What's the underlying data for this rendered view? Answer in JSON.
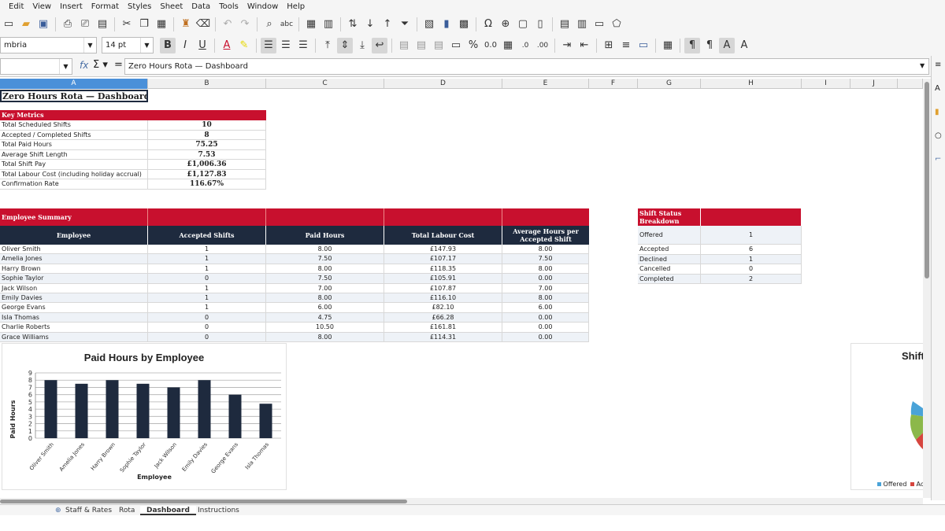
{
  "menu": [
    "Edit",
    "View",
    "Insert",
    "Format",
    "Styles",
    "Sheet",
    "Data",
    "Tools",
    "Window",
    "Help"
  ],
  "format": {
    "font_name": "mbria",
    "font_size": "14 pt"
  },
  "formula": {
    "name_box": "",
    "content": "Zero Hours Rota — Dashboard"
  },
  "columns": [
    "A",
    "B",
    "C",
    "D",
    "E",
    "F",
    "G",
    "H",
    "I",
    "J"
  ],
  "sheet_title": "Zero Hours Rota — Dashboard",
  "key_metrics": {
    "header": "Key Metrics",
    "rows": [
      {
        "label": "Total Scheduled Shifts",
        "value": "10"
      },
      {
        "label": "Accepted / Completed Shifts",
        "value": "8"
      },
      {
        "label": "Total Paid Hours",
        "value": "75.25"
      },
      {
        "label": "Average Shift Length",
        "value": "7.53"
      },
      {
        "label": "Total Shift Pay",
        "value": "£1,006.36"
      },
      {
        "label": "Total Labour Cost (including holiday accrual)",
        "value": "£1,127.83"
      },
      {
        "label": "Confirmation Rate",
        "value": "116.67%"
      }
    ]
  },
  "employee_summary": {
    "header": "Employee Summary",
    "columns": [
      "Employee",
      "Accepted Shifts",
      "Paid Hours",
      "Total Labour Cost",
      "Average Hours per Accepted Shift"
    ],
    "rows": [
      [
        "Oliver Smith",
        "1",
        "8.00",
        "£147.93",
        "8.00"
      ],
      [
        "Amelia Jones",
        "1",
        "7.50",
        "£107.17",
        "7.50"
      ],
      [
        "Harry Brown",
        "1",
        "8.00",
        "£118.35",
        "8.00"
      ],
      [
        "Sophie Taylor",
        "0",
        "7.50",
        "£105.91",
        "0.00"
      ],
      [
        "Jack Wilson",
        "1",
        "7.00",
        "£107.87",
        "7.00"
      ],
      [
        "Emily Davies",
        "1",
        "8.00",
        "£116.10",
        "8.00"
      ],
      [
        "George Evans",
        "1",
        "6.00",
        "£82.10",
        "6.00"
      ],
      [
        "Isla Thomas",
        "0",
        "4.75",
        "£66.28",
        "0.00"
      ],
      [
        "Charlie Roberts",
        "0",
        "10.50",
        "£161.81",
        "0.00"
      ],
      [
        "Grace Williams",
        "0",
        "8.00",
        "£114.31",
        "0.00"
      ]
    ]
  },
  "status_breakdown": {
    "header": "Shift Status Breakdown",
    "rows": [
      {
        "label": "Offered",
        "value": "1"
      },
      {
        "label": "Accepted",
        "value": "6"
      },
      {
        "label": "Declined",
        "value": "1"
      },
      {
        "label": "Cancelled",
        "value": "0"
      },
      {
        "label": "Completed",
        "value": "2"
      }
    ]
  },
  "chart_data": [
    {
      "type": "bar",
      "title": "Paid Hours by Employee",
      "xlabel": "Employee",
      "ylabel": "Paid Hours",
      "categories": [
        "Oliver Smith",
        "Amelia Jones",
        "Harry Brown",
        "Sophie Taylor",
        "Jack Wilson",
        "Emily Davies",
        "George Evans",
        "Isla Thomas"
      ],
      "values": [
        8,
        7.5,
        8,
        7.5,
        7,
        8,
        6,
        4.75
      ],
      "ylim": [
        0,
        9
      ],
      "yticks": [
        "0",
        "1",
        "2",
        "3",
        "4",
        "5",
        "6",
        "7",
        "8",
        "9"
      ],
      "grid": true,
      "color": "#1e2a3e"
    },
    {
      "type": "pie",
      "title": "Shift",
      "legend": [
        "Offered",
        "Acce"
      ],
      "colors": [
        "#4aa3d8",
        "#d6453e",
        "#8cb84a"
      ]
    }
  ],
  "tabs": [
    "Staff & Rates",
    "Rota",
    "Dashboard",
    "Instructions"
  ],
  "active_tab": "Dashboard"
}
